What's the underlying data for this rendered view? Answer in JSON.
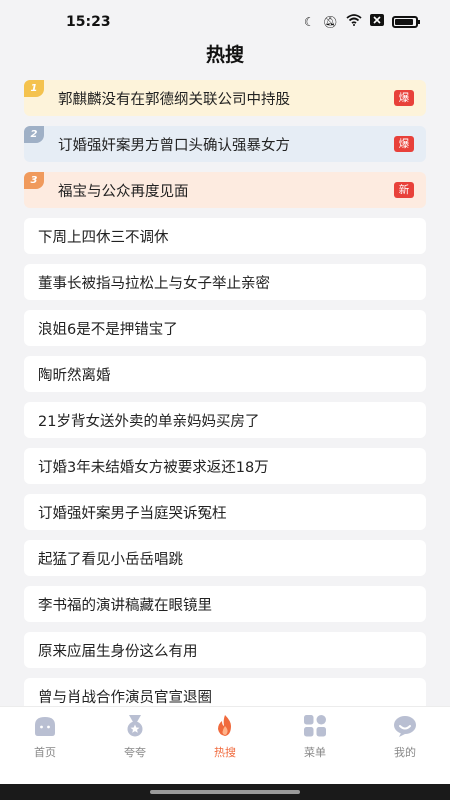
{
  "status": {
    "time": "15:23"
  },
  "page": {
    "title": "热搜"
  },
  "top_items": [
    {
      "rank": "1",
      "title": "郭麒麟没有在郭德纲关联公司中持股",
      "badge": "爆"
    },
    {
      "rank": "2",
      "title": "订婚强奸案男方曾口头确认强暴女方",
      "badge": "爆"
    },
    {
      "rank": "3",
      "title": "福宝与公众再度见面",
      "badge": "新"
    }
  ],
  "items": [
    "下周上四休三不调休",
    "董事长被指马拉松上与女子举止亲密",
    "浪姐6是不是押错宝了",
    "陶昕然离婚",
    "21岁背女送外卖的单亲妈妈买房了",
    "订婚3年未结婚女方被要求返还18万",
    "订婚强奸案男子当庭哭诉冤枉",
    "起猛了看见小岳岳唱跳",
    "李书福的演讲稿藏在眼镜里",
    "原来应届生身份这么有用",
    "曾与肖战合作演员官宣退圈"
  ],
  "tabs": [
    {
      "label": "首页",
      "icon": "home-icon"
    },
    {
      "label": "夸夸",
      "icon": "medal-icon"
    },
    {
      "label": "热搜",
      "icon": "flame-icon",
      "active": true
    },
    {
      "label": "菜单",
      "icon": "grid-menu-icon"
    },
    {
      "label": "我的",
      "icon": "profile-icon"
    }
  ],
  "colors": {
    "accent": "#f06a3d",
    "hot_badge": "#e8413a"
  }
}
